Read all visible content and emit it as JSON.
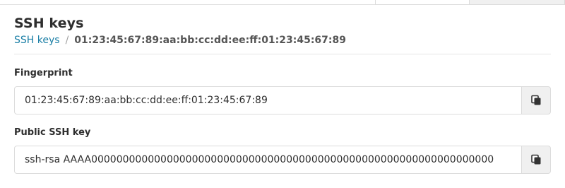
{
  "header": {
    "title": "SSH keys",
    "breadcrumb": {
      "parent": "SSH keys",
      "separator": "/",
      "current": "01:23:45:67:89:aa:bb:cc:dd:ee:ff:01:23:45:67:89"
    }
  },
  "fields": {
    "fingerprint": {
      "label": "Fingerprint",
      "value": "01:23:45:67:89:aa:bb:cc:dd:ee:ff:01:23:45:67:89",
      "copy_icon": "copy-icon"
    },
    "public_key": {
      "label": "Public SSH key",
      "value": "ssh-rsa AAAA0000000000000000000000000000000000000000000000000000000000000000",
      "copy_icon": "copy-icon"
    }
  },
  "colors": {
    "link": "#1b7fa6",
    "button_bg": "#f0f0f0",
    "border": "#dcdcdc"
  }
}
